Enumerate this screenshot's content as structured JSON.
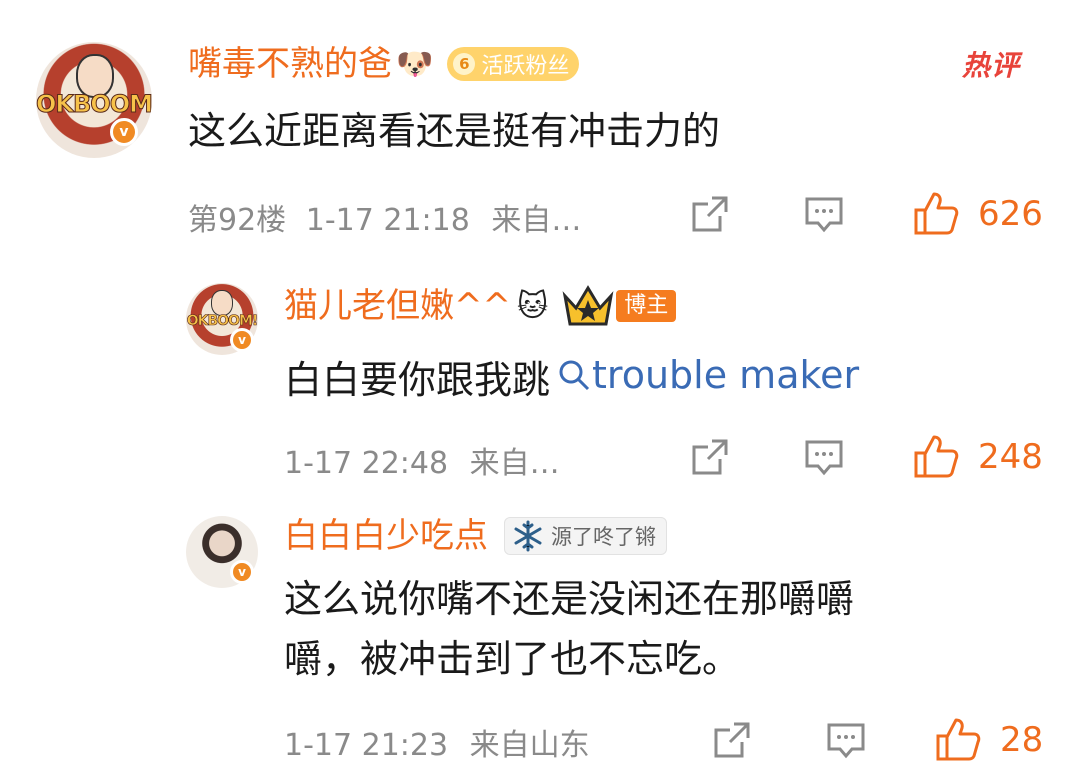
{
  "hot_label": "热评",
  "comments": [
    {
      "username": "嘴毒不熟的爸",
      "emoji": "🐶",
      "badge_level": "6",
      "badge_text": "活跃粉丝",
      "avatar_text": "OKBOOM!",
      "verified_icon": "v",
      "text": "这么近距离看还是挺有冲击力的",
      "floor": "第92楼",
      "time": "1-17 21:18",
      "source": "来自…",
      "likes": "626"
    },
    {
      "username": "猫儿老但嫩^^",
      "emoji": "🐱",
      "badge_text": "博主",
      "avatar_text": "OKBOOM!",
      "verified_icon": "v",
      "text": "白白要你跟我跳",
      "link_text": "trouble maker",
      "time": "1-17 22:48",
      "source": "来自…",
      "likes": "248"
    },
    {
      "username": "白白白少吃点",
      "badge_text": "源了咚了锵",
      "verified_icon": "v",
      "text_line1": "这么说你嘴不还是没闲还在那嚼嚼",
      "text_line2": "嚼，被冲击到了也不忘吃。",
      "time": "1-17 21:23",
      "source": "来自山东",
      "likes": "28"
    }
  ]
}
